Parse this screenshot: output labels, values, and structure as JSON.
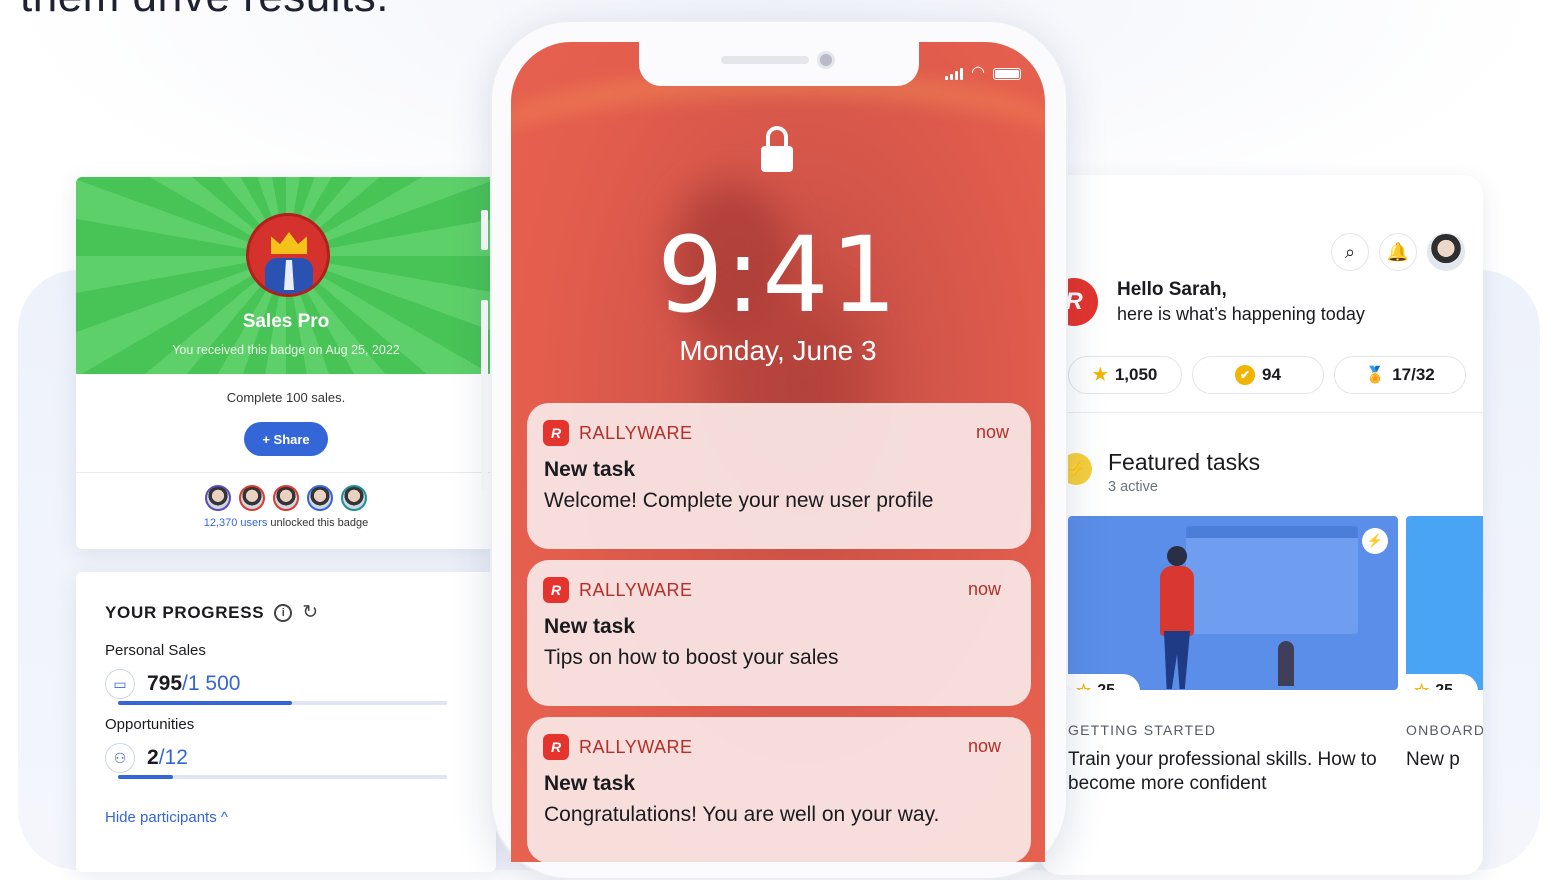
{
  "headline": "them drive results.",
  "badge_card": {
    "title": "Sales Pro",
    "received": "You received this badge on Aug 25, 2022",
    "description": "Complete 100 sales.",
    "share_label": "Share",
    "share_icon": "+",
    "users_count": "12,370 users",
    "users_suffix": " unlocked this badge",
    "avatar_rings": [
      "#5b4bb8",
      "#d93a32",
      "#d93a32",
      "#3566d8",
      "#1f8f98"
    ]
  },
  "progress_card": {
    "title": "YOUR PROGRESS",
    "info_icon": "i",
    "refresh_icon": "↻",
    "metrics": [
      {
        "label": "Personal Sales",
        "value": "795",
        "total": "/1 500",
        "icon": "▭",
        "fraction": 0.53
      },
      {
        "label": "Opportunities",
        "value": "2",
        "total": "/12",
        "icon": "⚇",
        "fraction": 0.167
      }
    ],
    "hide_link": "Hide participants ^"
  },
  "phone": {
    "time": "9:41",
    "date": "Monday, June 3",
    "notifications": [
      {
        "app": "RALLYWARE",
        "when": "now",
        "title": "New task",
        "message": "Welcome! Complete your new user profile"
      },
      {
        "app": "RALLYWARE",
        "when": "now",
        "title": "New task",
        "message": "Tips on how to boost your sales"
      },
      {
        "app": "RALLYWARE",
        "when": "now",
        "title": "New task",
        "message": "Congratulations! You are well on your way."
      }
    ],
    "app_icon_letter": "R"
  },
  "right_card": {
    "greeting": "Hello Sarah,",
    "greeting_sub": "here is what’s happening today",
    "logo_letter": "R",
    "search_icon": "⌕",
    "bell_icon": "🔔",
    "stats": [
      {
        "icon": "★",
        "color": "#f1b400",
        "value": "1,050"
      },
      {
        "icon": "✔",
        "color": "#f1b400",
        "value": "94"
      },
      {
        "icon": "🏅",
        "color": "#f1b400",
        "value": "17/32"
      }
    ],
    "featured_title": "Featured tasks",
    "featured_sub": "3 active",
    "featured_icon": "⚡",
    "tasks": [
      {
        "points": "25",
        "category": "GETTING STARTED",
        "title": "Train your professional skills. How to become more confident"
      },
      {
        "points": "25",
        "category": "ONBOARDING",
        "title": "New p"
      }
    ]
  },
  "colors": {
    "accent": "#3566d8",
    "brand_red": "#e4342d",
    "badge_green": "#4cc75a"
  }
}
